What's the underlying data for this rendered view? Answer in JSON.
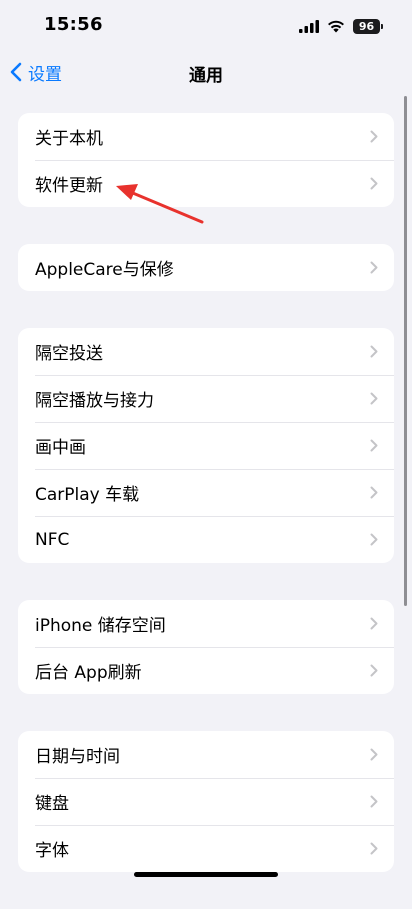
{
  "status": {
    "time": "15:56",
    "battery": "96"
  },
  "nav": {
    "back_label": "设置",
    "title": "通用"
  },
  "groups": [
    {
      "items": [
        {
          "label": "关于本机"
        },
        {
          "label": "软件更新"
        }
      ]
    },
    {
      "items": [
        {
          "label": "AppleCare与保修"
        }
      ]
    },
    {
      "items": [
        {
          "label": "隔空投送"
        },
        {
          "label": "隔空播放与接力"
        },
        {
          "label": "画中画"
        },
        {
          "label": "CarPlay 车载"
        },
        {
          "label": "NFC"
        }
      ]
    },
    {
      "items": [
        {
          "label": "iPhone 储存空间"
        },
        {
          "label": "后台 App刷新"
        }
      ]
    },
    {
      "items": [
        {
          "label": "日期与时间"
        },
        {
          "label": "键盘"
        },
        {
          "label": "字体"
        }
      ]
    }
  ],
  "colors": {
    "accent": "#0a7aff",
    "background": "#f2f2f7",
    "annotation_arrow": "#e8322d"
  },
  "icons": [
    "signal-icon",
    "wifi-icon",
    "battery-icon",
    "back-chevron-icon",
    "chevron-right-icon",
    "annotation-arrow"
  ]
}
